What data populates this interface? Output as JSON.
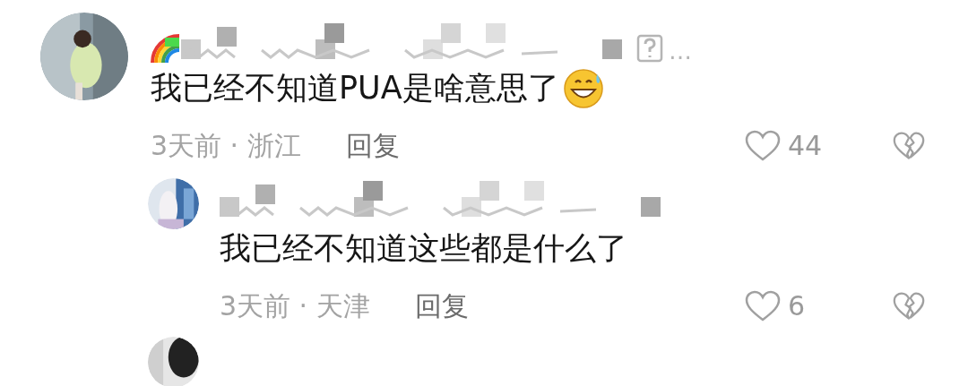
{
  "comments": [
    {
      "name_censored": true,
      "name_suffix": "…",
      "text": "我已经不知道PUA是啥意思了",
      "has_emoji": true,
      "time_location": "3天前 · 浙江",
      "reply_label": "回复",
      "likes": "44",
      "liked": false,
      "replies": [
        {
          "name_censored": true,
          "text": "我已经不知道这些都是什么了",
          "time_location": "3天前 · 天津",
          "reply_label": "回复",
          "likes": "6",
          "liked": false
        }
      ]
    }
  ]
}
